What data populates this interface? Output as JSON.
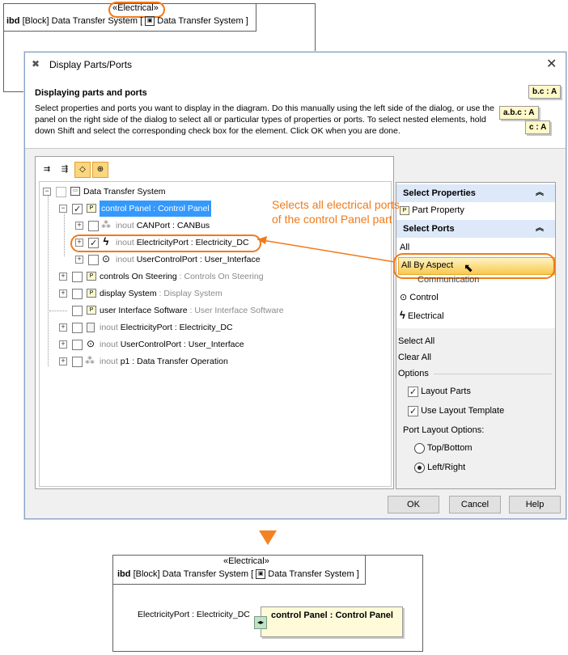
{
  "top_diagram": {
    "stereotype": "«Electrical»",
    "kind": "ibd",
    "block_tag": "[Block]",
    "title": "Data Transfer System",
    "bracket_open": "[",
    "bracket_title": "Data Transfer System",
    "bracket_close": "]"
  },
  "dialog": {
    "title": "Display Parts/Ports",
    "close": "✕",
    "header_title": "Displaying parts and ports",
    "header_desc": "Select properties and ports you want to display in the diagram. Do this manually using the left side of the dialog, or use the panel on the right side of the dialog to select all or particular types of properties or ports. To select nested elements, hold down Shift and select the corresponding check box for the element. Click OK when you are done.",
    "notes": [
      "b.c : A",
      "a.b.c : A",
      "c : A"
    ],
    "tree": {
      "root": "Data Transfer System",
      "rows": [
        {
          "name": "control Panel",
          "sep": " : ",
          "type": "Control Panel"
        },
        {
          "prefix": "inout ",
          "name": "CANPort",
          "sep": " : ",
          "type": "CANBus"
        },
        {
          "prefix": "inout ",
          "name": "ElectricityPort",
          "sep": " : ",
          "type": "Electricity_DC"
        },
        {
          "prefix": "inout ",
          "name": "UserControlPort",
          "sep": " : ",
          "type": "User_Interface"
        },
        {
          "name": "controls On Steering",
          "sep": " : ",
          "type": "Controls On Steering"
        },
        {
          "name": "display System",
          "sep": " : ",
          "type": "Display System"
        },
        {
          "name": "user Interface Software",
          "sep": " : ",
          "type": "User Interface Software"
        },
        {
          "prefix": "inout ",
          "name": "ElectricityPort",
          "sep": " : ",
          "type": "Electricity_DC"
        },
        {
          "prefix": "inout ",
          "name": "UserControlPort",
          "sep": " : ",
          "type": "User_Interface"
        },
        {
          "prefix": "inout ",
          "name": "p1",
          "sep": " : ",
          "type": "Data Transfer Operation"
        }
      ]
    },
    "right_panel": {
      "select_properties": "Select Properties",
      "part_property": "Part Property",
      "select_ports": "Select Ports",
      "all": "All",
      "all_by_aspect": "All By Aspect",
      "communication": "Communication",
      "control": "Control",
      "electrical": "Electrical",
      "select_all": "Select All",
      "clear_all": "Clear All",
      "options": "Options",
      "layout_parts": "Layout Parts",
      "use_layout_template": "Use Layout Template",
      "port_layout_options": "Port Layout Options:",
      "top_bottom": "Top/Bottom",
      "left_right": "Left/Right"
    },
    "buttons": {
      "ok": "OK",
      "cancel": "Cancel",
      "help": "Help"
    }
  },
  "callout": "Selects all electrical ports of the control Panel part",
  "bottom_diagram": {
    "stereotype": "«Electrical»",
    "kind": "ibd",
    "block_tag": "[Block]",
    "title": "Data Transfer System",
    "bracket_open": "[",
    "bracket_title": "Data Transfer System",
    "bracket_close": "]",
    "port_label": "ElectricityPort : Electricity_DC",
    "part_label": "control Panel : Control Panel"
  },
  "colors": {
    "accent_orange": "#f07a1a",
    "selection": "#3399ff",
    "section_header": "#dde8f8"
  }
}
